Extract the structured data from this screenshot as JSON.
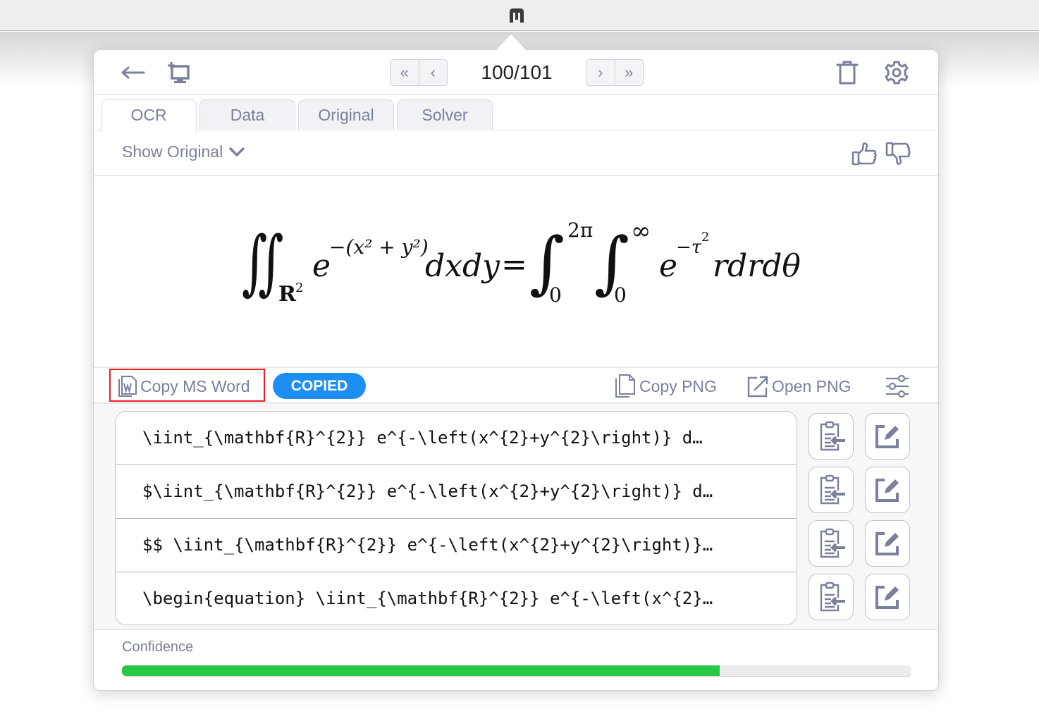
{
  "header": {
    "page_counter": "100/101"
  },
  "tabs": [
    {
      "label": "OCR",
      "active": true
    },
    {
      "label": "Data",
      "active": false
    },
    {
      "label": "Original",
      "active": false
    },
    {
      "label": "Solver",
      "active": false
    }
  ],
  "show_original": {
    "label": "Show Original"
  },
  "formula": {
    "lhs_subscript": "R",
    "lhs_subscript_exp": "2",
    "lhs_base": "e",
    "lhs_exponent": "−(x² + y²)",
    "lhs_differential": "dxdy",
    "equals": "=",
    "int1_upper": "2π",
    "int1_lower": "0",
    "int2_upper": "∞",
    "int2_lower": "0",
    "rhs_base": "e",
    "rhs_exponent_minus": "−τ",
    "rhs_exponent_sq": "2",
    "rhs_tail": "rdrdθ"
  },
  "actions": {
    "copy_ms_word": "Copy MS Word",
    "copied_badge": "COPIED",
    "copy_png": "Copy PNG",
    "open_png": "Open PNG"
  },
  "formats": [
    {
      "text": "\\iint_{\\mathbf{R}^{2}} e^{-\\left(x^{2}+y^{2}\\right)} d…"
    },
    {
      "text": "$\\iint_{\\mathbf{R}^{2}} e^{-\\left(x^{2}+y^{2}\\right)} d…"
    },
    {
      "text": "$$ \\iint_{\\mathbf{R}^{2}} e^{-\\left(x^{2}+y^{2}\\right)}…"
    },
    {
      "text": "\\begin{equation} \\iint_{\\mathbf{R}^{2}} e^{-\\left(x^{2}…"
    }
  ],
  "confidence": {
    "label": "Confidence",
    "value": 0.757,
    "color": "#28c845"
  },
  "colors": {
    "icon": "#7b809b",
    "accent": "#1d8ff3",
    "highlight": "#e8201f"
  }
}
